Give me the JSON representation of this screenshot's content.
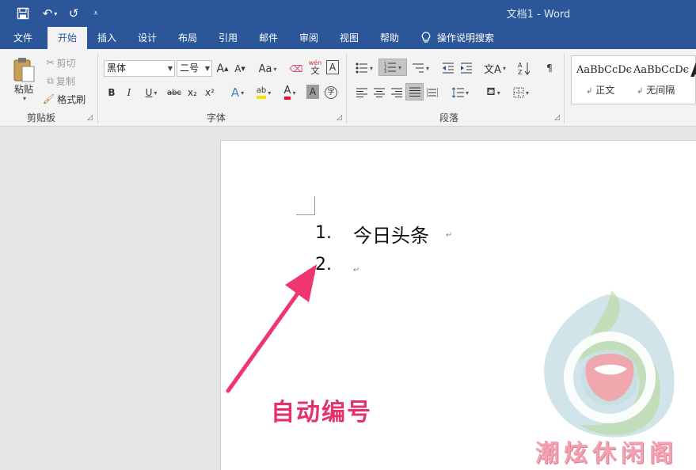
{
  "window": {
    "title": "文档1  -  Word"
  },
  "qat": {
    "save_icon": "save-icon",
    "undo_icon": "undo-icon",
    "redo_icon": "repeat-icon",
    "customize_icon": "customize-qat-icon",
    "undo_glyph": "↶",
    "redo_glyph": "↺",
    "customize_glyph": "⩡"
  },
  "tabs": [
    {
      "label": "文件"
    },
    {
      "label": "开始"
    },
    {
      "label": "插入"
    },
    {
      "label": "设计"
    },
    {
      "label": "布局"
    },
    {
      "label": "引用"
    },
    {
      "label": "邮件"
    },
    {
      "label": "审阅"
    },
    {
      "label": "视图"
    },
    {
      "label": "帮助"
    }
  ],
  "tell_me": {
    "icon": "lightbulb-icon",
    "label": "操作说明搜索"
  },
  "clipboard": {
    "paste_label": "粘贴",
    "cut_label": "剪切",
    "copy_label": "复制",
    "format_painter_label": "格式刷",
    "group_label": "剪贴板"
  },
  "font": {
    "font_name": "黑体",
    "font_size": "二号",
    "grow_label": "A",
    "shrink_label": "A",
    "change_case_label": "Aa",
    "bold": "B",
    "italic": "I",
    "underline": "U",
    "strikethrough": "abc",
    "subscript": "x₂",
    "superscript": "x²",
    "text_effects": "A",
    "highlight": "ab",
    "font_color": "A",
    "char_shading": "A",
    "enclose": "字",
    "phonetic": "wén",
    "phonetic_char": "文",
    "group_label": "字体",
    "highlight_color": "#f5e400",
    "font_color_value": "#e81123"
  },
  "paragraph": {
    "group_label": "段落"
  },
  "styles": {
    "items": [
      {
        "sample": "AaBbCcDє",
        "name": "正文"
      },
      {
        "sample": "AaBbCcDє",
        "name": "无间隔"
      }
    ],
    "style_marker": "↲",
    "overflow_glyph": "A"
  },
  "document": {
    "list": [
      {
        "number": "1.",
        "text": "今日头条"
      },
      {
        "number": "2.",
        "text": ""
      }
    ],
    "paragraph_mark": "↵"
  },
  "annotation": {
    "text": "自动编号",
    "color": "#e5306a"
  },
  "watermark": {
    "text": "潮炫休闲阁"
  },
  "colors": {
    "accent": "#2b579a",
    "arrow": "#f0366e"
  }
}
